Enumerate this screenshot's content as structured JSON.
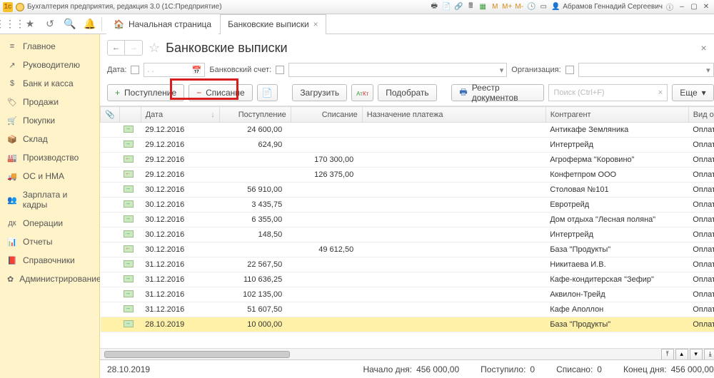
{
  "app": {
    "title": "Бухгалтерия предприятия, редакция 3.0 (1С:Предприятие)",
    "user": "Абрамов Геннадий Сергеевич"
  },
  "topicons": {
    "m": "M",
    "mp": "M+",
    "mm": "M-"
  },
  "sidebar": {
    "items": [
      {
        "label": "Главное"
      },
      {
        "label": "Руководителю"
      },
      {
        "label": "Банк и касса"
      },
      {
        "label": "Продажи"
      },
      {
        "label": "Покупки"
      },
      {
        "label": "Склад"
      },
      {
        "label": "Производство"
      },
      {
        "label": "ОС и НМА"
      },
      {
        "label": "Зарплата и кадры"
      },
      {
        "label": "Операции"
      },
      {
        "label": "Отчеты"
      },
      {
        "label": "Справочники"
      },
      {
        "label": "Администрирование"
      }
    ]
  },
  "tabs": {
    "home": "Начальная страница",
    "active": "Банковские выписки"
  },
  "page": {
    "title": "Банковские выписки"
  },
  "filters": {
    "date_lbl": "Дата:",
    "date_ph": ". .",
    "acct_lbl": "Банковский счет:",
    "org_lbl": "Организация:"
  },
  "actions": {
    "add_in": "Поступление",
    "add_out": "Списание",
    "load": "Загрузить",
    "pick": "Подобрать",
    "reg": "Реестр документов",
    "more": "Еще",
    "search_ph": "Поиск (Ctrl+F)"
  },
  "columns": {
    "c0": "📎",
    "c1": "Дата",
    "c2": "Поступление",
    "c3": "Списание",
    "c4": "Назначение платежа",
    "c5": "Контрагент",
    "c6": "Вид о"
  },
  "rows": [
    {
      "date": "29.12.2016",
      "in": "24 600,00",
      "out": "",
      "ca": "Антикафе Земляника",
      "op": "Оплат"
    },
    {
      "date": "29.12.2016",
      "in": "624,90",
      "out": "",
      "ca": "Интертрейд",
      "op": "Оплат"
    },
    {
      "date": "29.12.2016",
      "in": "",
      "out": "170 300,00",
      "ca": "Агроферма \"Коровино\"",
      "op": "Оплат"
    },
    {
      "date": "29.12.2016",
      "in": "",
      "out": "126 375,00",
      "ca": "Конфетпром ООО",
      "op": "Оплат"
    },
    {
      "date": "30.12.2016",
      "in": "56 910,00",
      "out": "",
      "ca": "Столовая №101",
      "op": "Оплат"
    },
    {
      "date": "30.12.2016",
      "in": "3 435,75",
      "out": "",
      "ca": "Евротрейд",
      "op": "Оплат"
    },
    {
      "date": "30.12.2016",
      "in": "6 355,00",
      "out": "",
      "ca": "Дом отдыха \"Лесная поляна\"",
      "op": "Оплат"
    },
    {
      "date": "30.12.2016",
      "in": "148,50",
      "out": "",
      "ca": "Интертрейд",
      "op": "Оплат"
    },
    {
      "date": "30.12.2016",
      "in": "",
      "out": "49 612,50",
      "ca": "База \"Продукты\"",
      "op": "Оплат"
    },
    {
      "date": "31.12.2016",
      "in": "22 567,50",
      "out": "",
      "ca": "Никитаева И.В.",
      "op": "Оплат"
    },
    {
      "date": "31.12.2016",
      "in": "110 636,25",
      "out": "",
      "ca": "Кафе-кондитерская \"Зефир\"",
      "op": "Оплат"
    },
    {
      "date": "31.12.2016",
      "in": "102 135,00",
      "out": "",
      "ca": "Аквилон-Трейд",
      "op": "Оплат"
    },
    {
      "date": "31.12.2016",
      "in": "51 607,50",
      "out": "",
      "ca": "Кафе Аполлон",
      "op": "Оплат"
    },
    {
      "date": "28.10.2019",
      "in": "10 000,00",
      "out": "",
      "ca": "База \"Продукты\"",
      "op": "Оплат"
    }
  ],
  "status": {
    "date": "28.10.2019",
    "start_lbl": "Начало дня:",
    "start_v": "456 000,00",
    "in_lbl": "Поступило:",
    "in_v": "0",
    "out_lbl": "Списано:",
    "out_v": "0",
    "end_lbl": "Конец дня:",
    "end_v": "456 000,00"
  }
}
